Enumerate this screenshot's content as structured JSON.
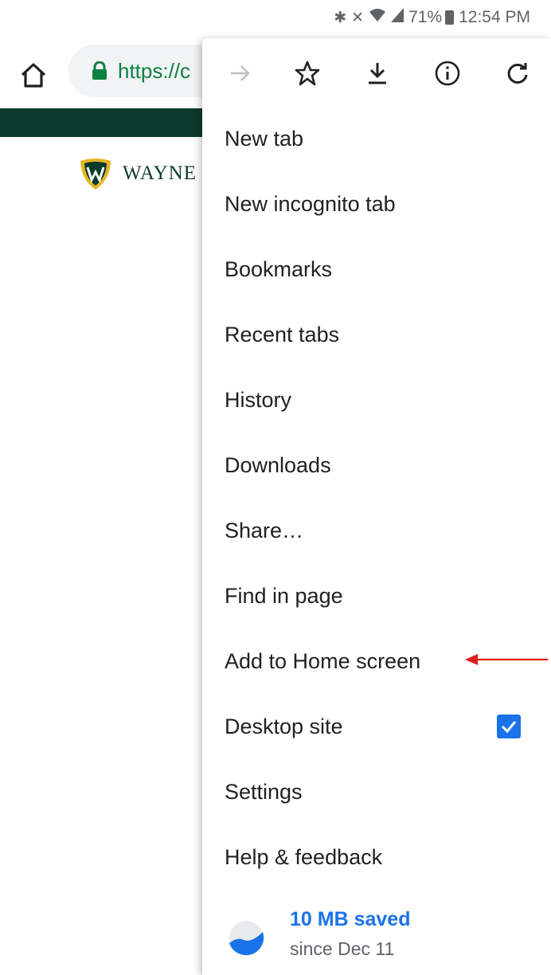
{
  "status_bar": {
    "battery": "71%",
    "time": "12:54 PM"
  },
  "toolbar": {
    "url": "https://c"
  },
  "page": {
    "logo_text": "WAYNE",
    "brand_color": "#0c3b2e"
  },
  "menu": {
    "icons": [
      "forward-icon",
      "star-icon",
      "download-icon",
      "info-icon",
      "refresh-icon"
    ],
    "items": [
      {
        "label": "New tab"
      },
      {
        "label": "New incognito tab"
      },
      {
        "label": "Bookmarks"
      },
      {
        "label": "Recent tabs"
      },
      {
        "label": "History"
      },
      {
        "label": "Downloads"
      },
      {
        "label": "Share…"
      },
      {
        "label": "Find in page"
      },
      {
        "label": "Add to Home screen"
      },
      {
        "label": "Desktop site",
        "checked": true
      },
      {
        "label": "Settings"
      },
      {
        "label": "Help & feedback"
      }
    ],
    "saved": {
      "title": "10 MB saved",
      "subtitle": "since Dec 11"
    }
  },
  "colors": {
    "accent": "#1a73e8",
    "secure": "#0b8043",
    "annotation": "#e01e1e"
  }
}
